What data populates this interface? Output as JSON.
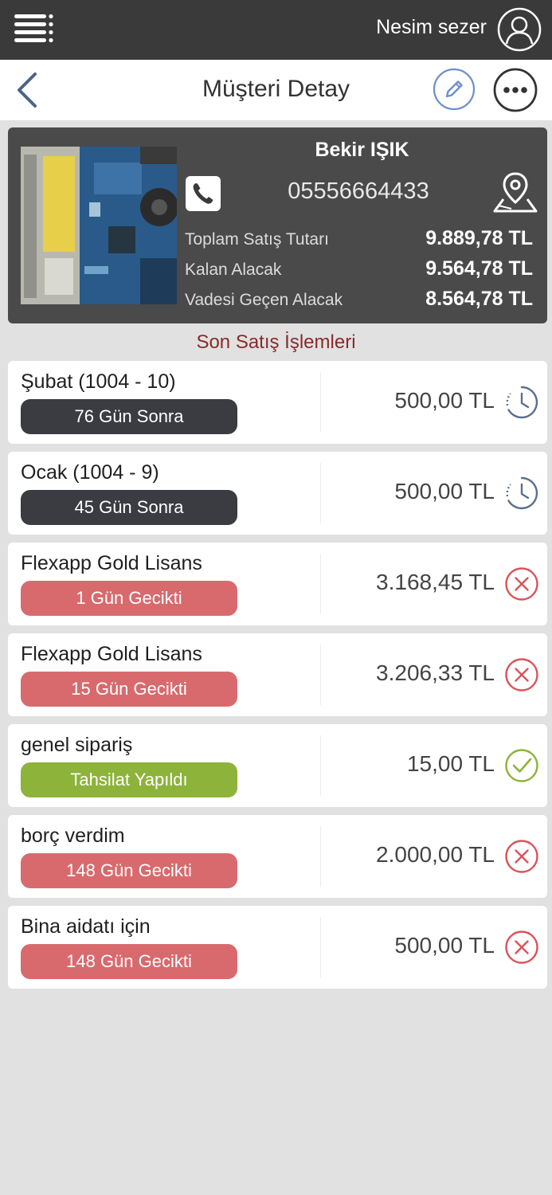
{
  "header": {
    "user_name": "Nesim sezer"
  },
  "titlebar": {
    "title": "Müşteri Detay"
  },
  "customer": {
    "name": "Bekir IŞIK",
    "phone": "05556664433",
    "summary": [
      {
        "label": "Toplam Satış Tutarı",
        "value": "9.889,78 TL"
      },
      {
        "label": "Kalan Alacak",
        "value": "9.564,78 TL"
      },
      {
        "label": "Vadesi Geçen Alacak",
        "value": "8.564,78 TL"
      }
    ]
  },
  "section_title": "Son Satış İşlemleri",
  "transactions": [
    {
      "title": "Şubat (1004 - 10)",
      "status": "76 Gün Sonra",
      "status_type": "upcoming",
      "amount": "500,00 TL",
      "icon": "clock-icon"
    },
    {
      "title": "Ocak (1004 - 9)",
      "status": "45 Gün Sonra",
      "status_type": "upcoming",
      "amount": "500,00 TL",
      "icon": "clock-icon"
    },
    {
      "title": "Flexapp Gold Lisans",
      "status": "1 Gün Gecikti",
      "status_type": "overdue",
      "amount": "3.168,45 TL",
      "icon": "x-circle-icon"
    },
    {
      "title": "Flexapp Gold Lisans",
      "status": "15 Gün Gecikti",
      "status_type": "overdue",
      "amount": "3.206,33 TL",
      "icon": "x-circle-icon"
    },
    {
      "title": "genel sipariş",
      "status": "Tahsilat Yapıldı",
      "status_type": "paid",
      "amount": "15,00 TL",
      "icon": "check-circle-icon"
    },
    {
      "title": "borç verdim",
      "status": "148 Gün Gecikti",
      "status_type": "overdue",
      "amount": "2.000,00 TL",
      "icon": "x-circle-icon"
    },
    {
      "title": "Bina aidatı için",
      "status": "148 Gün Gecikti",
      "status_type": "overdue",
      "amount": "500,00 TL",
      "icon": "x-circle-icon"
    }
  ],
  "colors": {
    "topbar": "#3a3a3a",
    "card": "#4a4a4a",
    "upcoming": "#3a3c42",
    "overdue": "#d86a6e",
    "paid": "#8db33a",
    "clock_icon": "#5a6f8f",
    "x_icon": "#d9545a",
    "check_icon": "#8db33a",
    "edit_icon": "#6e8fc9",
    "section_title": "#8a2a2a"
  }
}
